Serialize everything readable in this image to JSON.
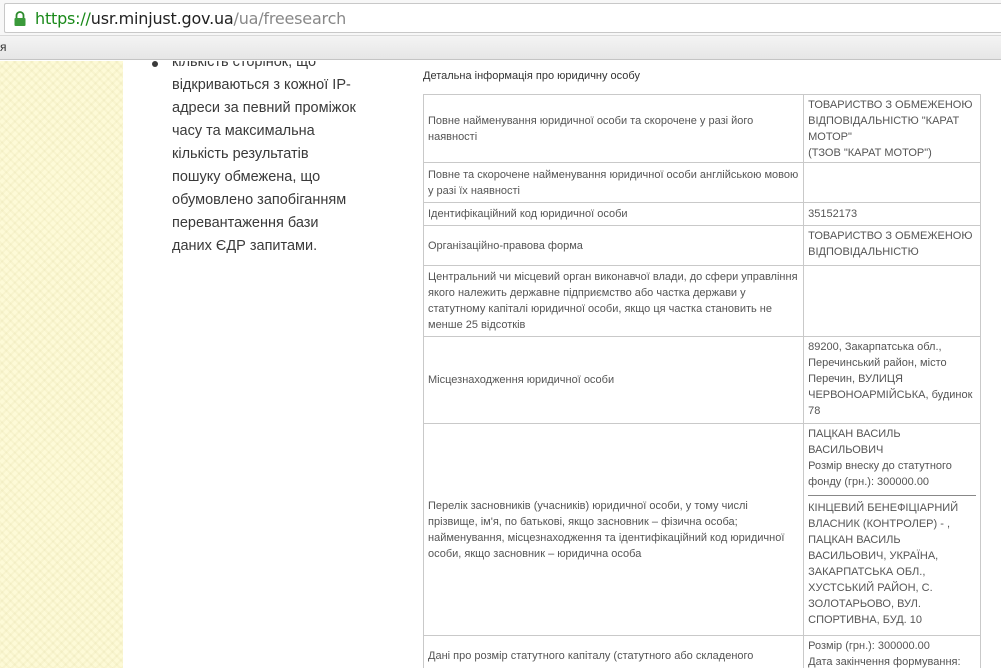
{
  "browser": {
    "url_scheme": "https://",
    "url_host": "usr.minjust.gov.ua",
    "url_path": "/ua/freesearch",
    "bookmark_fragment": "я"
  },
  "sidebar_text": {
    "lines": [
      "кількість сторінок, що",
      "відкриваються з кожної IP-",
      "адреси за певний проміжок",
      "часу та максимальна",
      "кількість результатів",
      "пошуку обмежена, що",
      "обумовлено запобіганням",
      "перевантаження бази",
      "даних ЄДР запитами."
    ]
  },
  "section_title": "Детальна інформація про юридичну особу",
  "rows": [
    {
      "label": "Повне найменування юридичної особи та скорочене у разі його наявності",
      "value_lines": [
        "ТОВАРИСТВО З ОБМЕЖЕНОЮ",
        "ВІДПОВІДАЛЬНІСТЮ \"КАРАТ",
        "МОТОР\"",
        "(ТЗОВ \"КАРАТ МОТОР\")"
      ]
    },
    {
      "label": "Повне та скорочене найменування юридичної особи англійською мовою у разі їх наявності",
      "value_lines": []
    },
    {
      "label": "Ідентифікаційний код юридичної особи",
      "value_lines": [
        "35152173"
      ]
    },
    {
      "label": "Організаційно-правова форма",
      "value_lines": [
        "ТОВАРИСТВО З ОБМЕЖЕНОЮ",
        "ВІДПОВІДАЛЬНІСТЮ"
      ]
    },
    {
      "label": "Центральний чи місцевий орган виконавчої влади, до сфери управління якого належить державне підприємство або частка держави у статутному капіталі юридичної особи, якщо ця частка становить не менше 25 відсотків",
      "value_lines": []
    },
    {
      "label": "Місцезнаходження юридичної особи",
      "value_lines": [
        "89200, Закарпатська обл.,",
        "Перечинський район, місто",
        "Перечин, ВУЛИЦЯ",
        "ЧЕРВОНОАРМІЙСЬКА, будинок",
        "78"
      ]
    },
    {
      "label": "Перелік засновників (учасників) юридичної особи, у тому числі прізвище, ім'я, по батькові, якщо засновник – фізична особа; найменування, місцезнаходження та ідентифікаційний код юридичної особи, якщо засновник – юридична особа",
      "value_lines": [
        "ПАЦКАН ВАСИЛЬ",
        "ВАСИЛЬОВИЧ",
        "Розмір внеску до статутного",
        "фонду (грн.): 300000.00"
      ],
      "value_lines_2": [
        "КІНЦЕВИЙ БЕНЕФІЦІАРНИЙ",
        "ВЛАСНИК (КОНТРОЛЕР) - ,",
        "ПАЦКАН ВАСИЛЬ",
        "ВАСИЛЬОВИЧ, УКРАЇНА,",
        "ЗАКАРПАТСЬКА ОБЛ.,",
        "ХУСТСЬКИЙ РАЙОН, С.",
        "ЗОЛОТАРЬОВО, ВУЛ.",
        "СПОРТИВНА, БУД. 10"
      ]
    },
    {
      "label": "Дані про розмір статутного капіталу (статутного або складеного",
      "value_lines": [
        "Розмір (грн.): 300000.00",
        "Дата закінчення формування:"
      ]
    }
  ]
}
